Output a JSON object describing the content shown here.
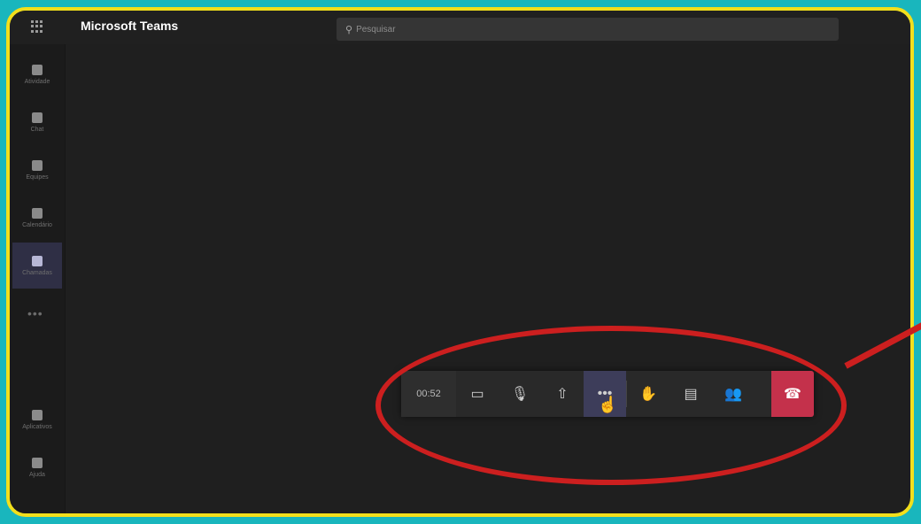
{
  "app": {
    "title": "Microsoft Teams"
  },
  "search": {
    "placeholder": "Pesquisar"
  },
  "rail": {
    "items": [
      {
        "label": "Atividade",
        "icon": "bell-icon"
      },
      {
        "label": "Chat",
        "icon": "chat-icon"
      },
      {
        "label": "Equipes",
        "icon": "teams-icon"
      },
      {
        "label": "Calendário",
        "icon": "calendar-icon"
      },
      {
        "label": "Chamadas",
        "icon": "calls-icon",
        "active": true
      }
    ],
    "more": "•••",
    "bottom_items": [
      {
        "label": "Aplicativos",
        "icon": "apps-icon"
      },
      {
        "label": "Ajuda",
        "icon": "help-icon"
      }
    ]
  },
  "call_toolbar": {
    "timer": "00:52",
    "buttons": [
      {
        "name": "camera",
        "icon": "camera-off-icon",
        "glyph": "▭"
      },
      {
        "name": "mic",
        "icon": "mic-icon",
        "glyph": "🎙"
      },
      {
        "name": "share",
        "icon": "share-screen-icon",
        "glyph": "⇧"
      },
      {
        "name": "more",
        "icon": "more-options-icon",
        "glyph": "•••"
      },
      {
        "name": "raise-hand",
        "icon": "raise-hand-icon",
        "glyph": "✋"
      },
      {
        "name": "chat",
        "icon": "chat-icon",
        "glyph": "▤"
      },
      {
        "name": "participants",
        "icon": "participants-icon",
        "glyph": "👥"
      }
    ],
    "hangup_glyph": "☎"
  },
  "colors": {
    "outer_bg": "#19b6bd",
    "frame_border": "#f2df1c",
    "app_bg": "#1f1f1f",
    "hangup": "#c4314b",
    "annotation": "#cc1f1f"
  }
}
